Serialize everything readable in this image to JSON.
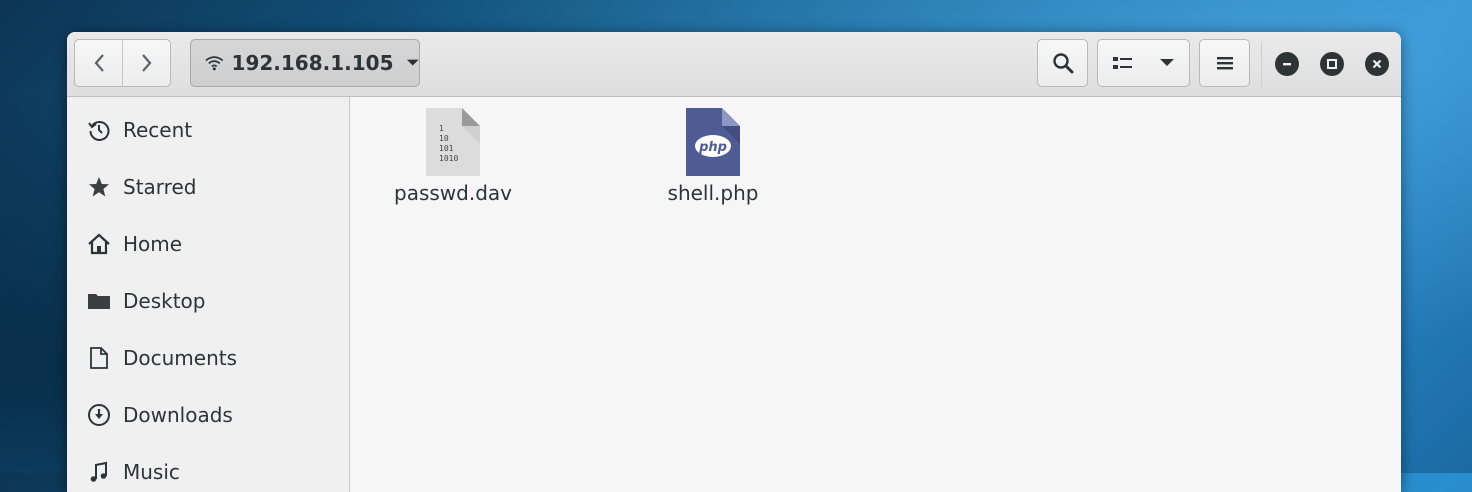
{
  "headerbar": {
    "path_label": "192.168.1.105"
  },
  "sidebar": {
    "items": [
      {
        "label": "Recent",
        "icon": "recent-icon"
      },
      {
        "label": "Starred",
        "icon": "star-icon"
      },
      {
        "label": "Home",
        "icon": "home-icon"
      },
      {
        "label": "Desktop",
        "icon": "folder-icon"
      },
      {
        "label": "Documents",
        "icon": "document-icon"
      },
      {
        "label": "Downloads",
        "icon": "download-icon"
      },
      {
        "label": "Music",
        "icon": "music-icon"
      }
    ]
  },
  "files": [
    {
      "name": "passwd.dav",
      "icon": "binary-file-icon"
    },
    {
      "name": "shell.php",
      "icon": "php-file-icon"
    }
  ],
  "colors": {
    "php_icon": "#4f5b93",
    "binary_icon": "#dcdcdc",
    "text": "#2e3436"
  }
}
